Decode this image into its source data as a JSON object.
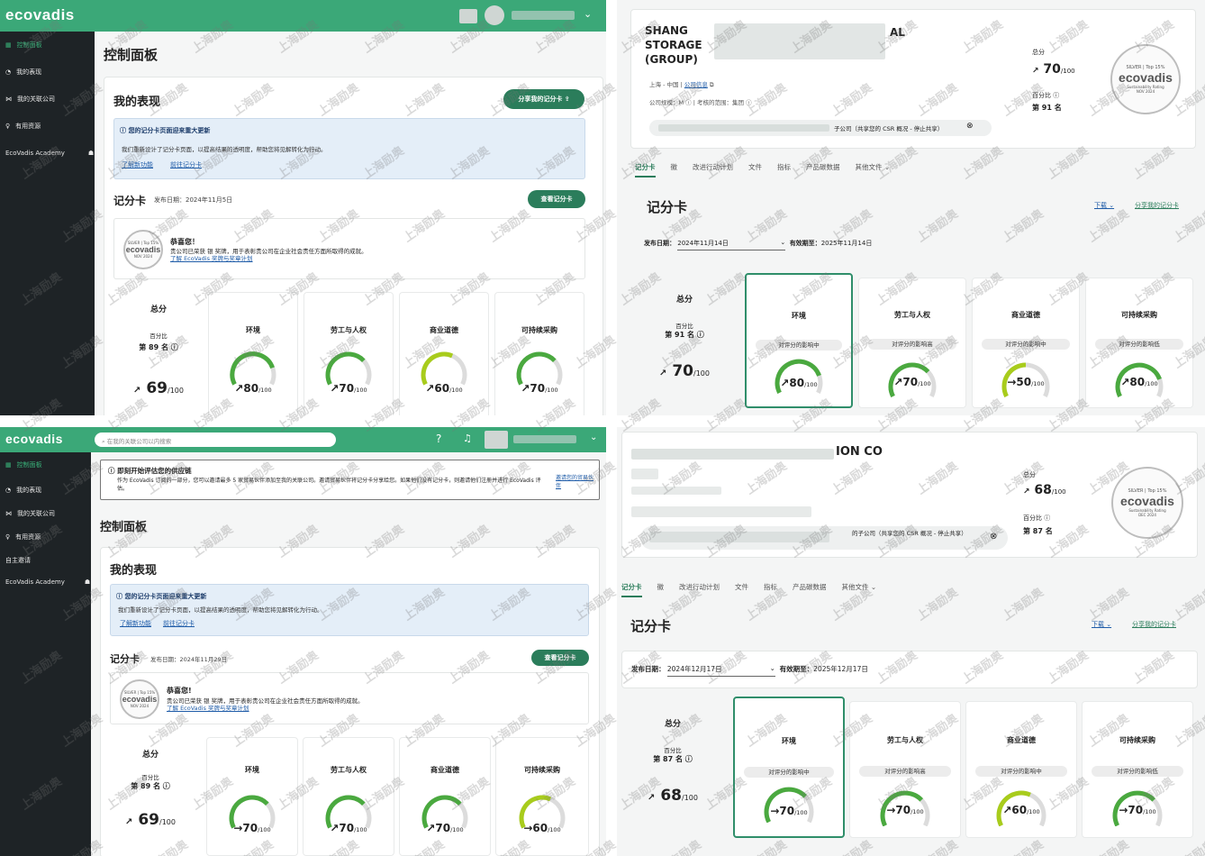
{
  "brand": "ecovadis",
  "q1": {
    "sidebar": [
      "控制面板",
      "我的表现",
      "我的关联公司",
      "有用资源",
      "EcoVadis Academy"
    ],
    "page_title": "控制面板",
    "perf_title": "我的表现",
    "share_btn": "分享我的记分卡",
    "notice_title": "您的记分卡页面迎来重大更新",
    "notice_body": "我们重新设计了记分卡页面，以提高结果的透明度，帮助您将见解转化为行动。",
    "link_learn": "了解新功能",
    "link_go": "前往记分卡",
    "scorecard": "记分卡",
    "pub_label": "发布日期：",
    "pub_date": "2024年11月5日",
    "view_btn": "查看记分卡",
    "congrats": "恭喜您！",
    "congrats_body": "贵公司已荣获 银 奖牌，用于表彰贵公司在企业社会责任方面所取得的成就。",
    "congrats_link": "了解 EcoVadis 奖牌与奖章计划",
    "badge_top": "SILVER | Top 15%",
    "badge_name": "ecovadis",
    "badge_date": "NOV 2024",
    "overall": "总分",
    "pct_label": "百分比",
    "rank": "第 89 名",
    "total": "69",
    "scores": [
      {
        "t": "环境",
        "v": "80"
      },
      {
        "t": "劳工与人权",
        "v": "70"
      },
      {
        "t": "商业道德",
        "v": "60"
      },
      {
        "t": "可持续采购",
        "v": "70"
      }
    ]
  },
  "q2": {
    "company": [
      "SHANG",
      "STORAGE",
      "(GROUP)"
    ],
    "company_suffix": "AL",
    "location": "上海 - 中国",
    "loc_link": "公司信息",
    "size_label": "公司规模：",
    "size": "M",
    "scope_label": "考核的范围：",
    "scope": "集团",
    "sub_note": "子公司（共享您的 CSR 概况 - 停止共享）",
    "total_label": "总分",
    "total": "70",
    "pct_label": "百分比",
    "rank": "第 91 名",
    "badge_top": "SILVER | Top 15%",
    "badge_name": "ecovadis",
    "badge_sub": "Sustainability Rating",
    "badge_date": "NOV 2024",
    "tabs": [
      "记分卡",
      "徽",
      "改进行动计划",
      "文件",
      "指标",
      "产品碳数据",
      "其他文件"
    ],
    "scorecard": "记分卡",
    "download": "下载",
    "share": "分享我的记分卡",
    "pub_label": "发布日期：",
    "pub_date": "2024年11月14日",
    "valid_label": "有效期至：",
    "valid_date": "2025年11月14日",
    "overall": "总分",
    "scores": [
      {
        "t": "环境",
        "i": "对评分的影响中",
        "v": "80"
      },
      {
        "t": "劳工与人权",
        "i": "对评分的影响高",
        "v": "70"
      },
      {
        "t": "商业道德",
        "i": "对评分的影响中",
        "v": "50"
      },
      {
        "t": "可持续采购",
        "i": "对评分的影响低",
        "v": "80"
      }
    ]
  },
  "q3": {
    "search_placeholder": "在我的关联公司以内搜索",
    "sidebar": [
      "控制面板",
      "我的表现",
      "我的关联公司",
      "有用资源",
      "自主邀请",
      "EcoVadis Academy"
    ],
    "banner_title": "即刻开始评估您的供应链",
    "banner_body": "作为 EcoVadis 订阅的一部分，您可以邀请最多 5 家贸易伙伴添加至我的关联公司。邀请贸易伙伴将记分卡分享给您。如果他们没有记分卡，则邀请他们注册并进行 EcoVadis 评估。",
    "banner_btn": "邀请您的贸易伙伴",
    "page_title": "控制面板",
    "perf_title": "我的表现",
    "notice_title": "您的记分卡页面迎来重大更新",
    "notice_body": "我们重新设计了记分卡页面，以提高结果的透明度，帮助您将见解转化为行动。",
    "link_learn": "了解新功能",
    "link_go": "前往记分卡",
    "scorecard": "记分卡",
    "pub_label": "发布日期：",
    "pub_date": "2024年11月29日",
    "view_btn": "查看记分卡",
    "congrats": "恭喜您!",
    "congrats_body": "贵公司已荣获 银 奖牌，用于表彰贵公司在企业社会责任方面所取得的成就。",
    "congrats_link": "了解 EcoVadis 奖牌与奖章计划",
    "badge_top": "SILVER | Top 15%",
    "badge_name": "ecovadis",
    "badge_date": "NOV 2024",
    "overall": "总分",
    "pct_label": "百分比",
    "rank": "第 89 名",
    "total": "69",
    "scores": [
      {
        "t": "环境",
        "v": "70"
      },
      {
        "t": "劳工与人权",
        "v": "70"
      },
      {
        "t": "商业道德",
        "v": "70"
      },
      {
        "t": "可持续采购",
        "v": "60"
      }
    ]
  },
  "q4": {
    "company_suffix": "ION CO",
    "sub_note": "的子公司（共享您的 CSR 概况 - 停止共享）",
    "total_label": "总分",
    "total": "68",
    "pct_label": "百分比",
    "rank": "第 87 名",
    "badge_top": "SILVER | Top 15%",
    "badge_name": "ecovadis",
    "badge_sub": "Sustainability Rating",
    "badge_date": "DEC 2024",
    "tabs": [
      "记分卡",
      "徽",
      "改进行动计划",
      "文件",
      "指标",
      "产品碳数据",
      "其他文件"
    ],
    "scorecard": "记分卡",
    "download": "下载",
    "share": "分享我的记分卡",
    "pub_label": "发布日期：",
    "pub_date": "2024年12月17日",
    "valid_label": "有效期至：",
    "valid_date": "2025年12月17日",
    "overall": "总分",
    "scores": [
      {
        "t": "环境",
        "i": "对评分的影响中",
        "v": "70"
      },
      {
        "t": "劳工与人权",
        "i": "对评分的影响高",
        "v": "70"
      },
      {
        "t": "商业道德",
        "i": "对评分的影响中",
        "v": "60"
      },
      {
        "t": "可持续采购",
        "i": "对评分的影响低",
        "v": "70"
      }
    ]
  },
  "denom": "/100",
  "watermark": "上海励奥",
  "colors": {
    "brand": "#3ba878",
    "dark_btn": "#2b7d5b",
    "sidebar": "#1e2326",
    "gauge_green": "#4aa93f",
    "gauge_lime": "#a8cc1c"
  }
}
